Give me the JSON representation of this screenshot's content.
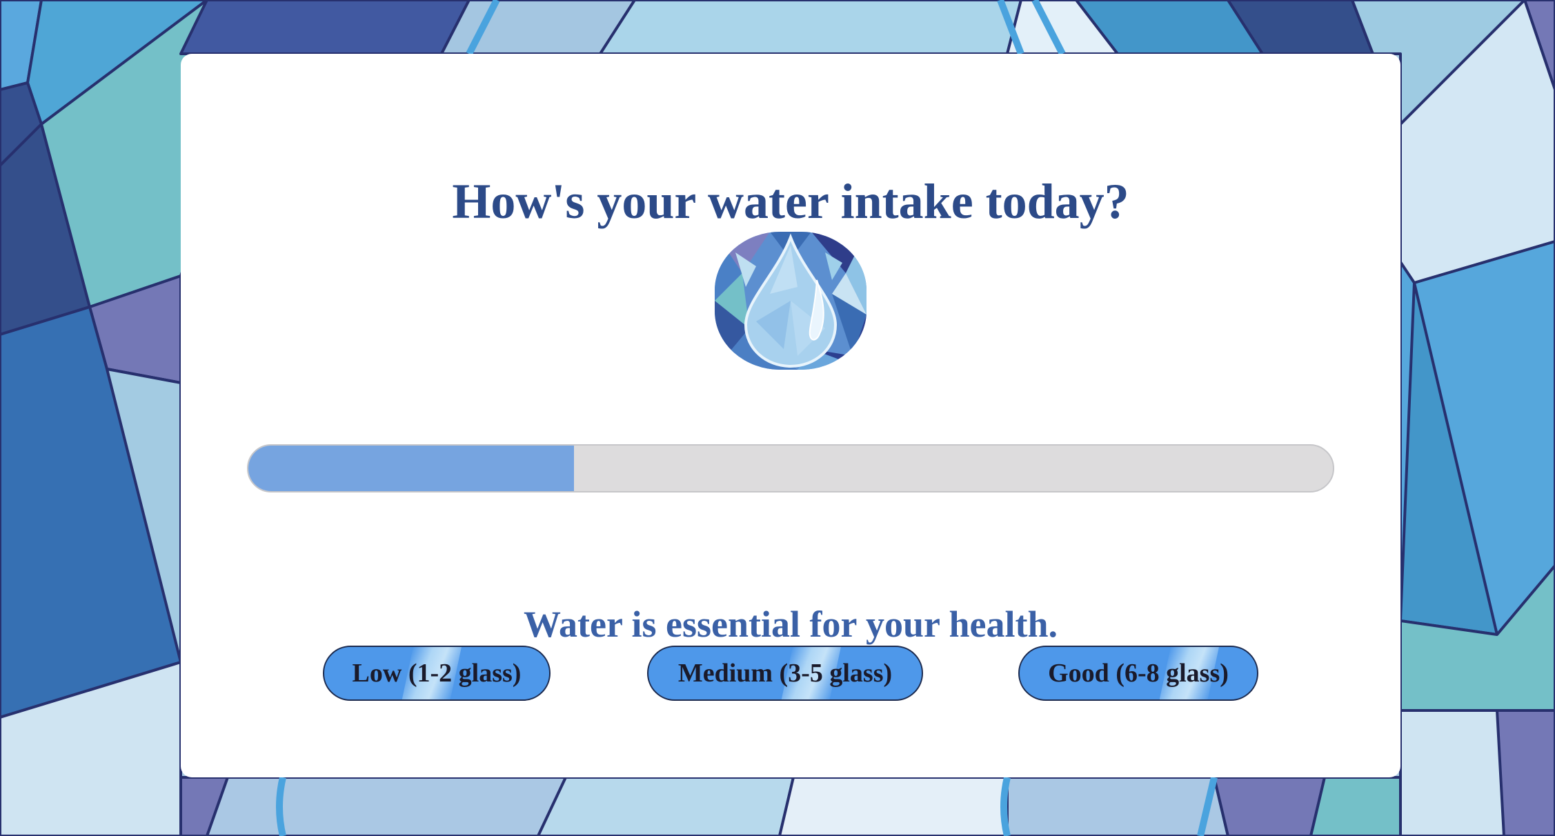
{
  "page": {
    "title": "How's your water intake today?",
    "message": "Water is essential for your health.",
    "icon": "water-drop-icon"
  },
  "progress": {
    "fraction": 0.3
  },
  "options": [
    {
      "label": "Low (1-2 glass)"
    },
    {
      "label": "Medium (3-5 glass)"
    },
    {
      "label": "Good (6-8 glass)"
    }
  ],
  "colors": {
    "title": "#2c4a88",
    "message": "#3a60a6",
    "button": "#4e98ea",
    "progress_fill": "#76a4e0",
    "progress_track": "#dddcdd"
  }
}
